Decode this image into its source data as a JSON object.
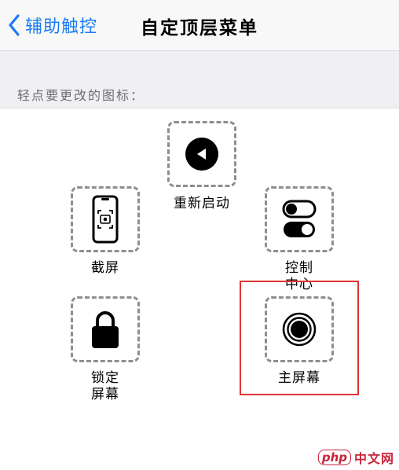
{
  "navbar": {
    "back_label": "辅助触控",
    "title": "自定顶层菜单"
  },
  "section": {
    "header": "轻点要更改的图标："
  },
  "tiles": [
    {
      "id": "restart",
      "label": "重新启动",
      "icon": "play-left-icon"
    },
    {
      "id": "screenshot",
      "label": "截屏",
      "icon": "screenshot-phone-icon"
    },
    {
      "id": "control-center",
      "label": "控制\n中心",
      "icon": "toggles-icon"
    },
    {
      "id": "lock-screen",
      "label": "锁定\n屏幕",
      "icon": "lock-icon"
    },
    {
      "id": "home",
      "label": "主屏幕",
      "icon": "home-button-icon"
    }
  ],
  "highlight": {
    "target": "home",
    "color": "#e03434"
  },
  "accent_color": "#1a7cf5",
  "watermark": {
    "logo": "php",
    "text": "中文网"
  }
}
